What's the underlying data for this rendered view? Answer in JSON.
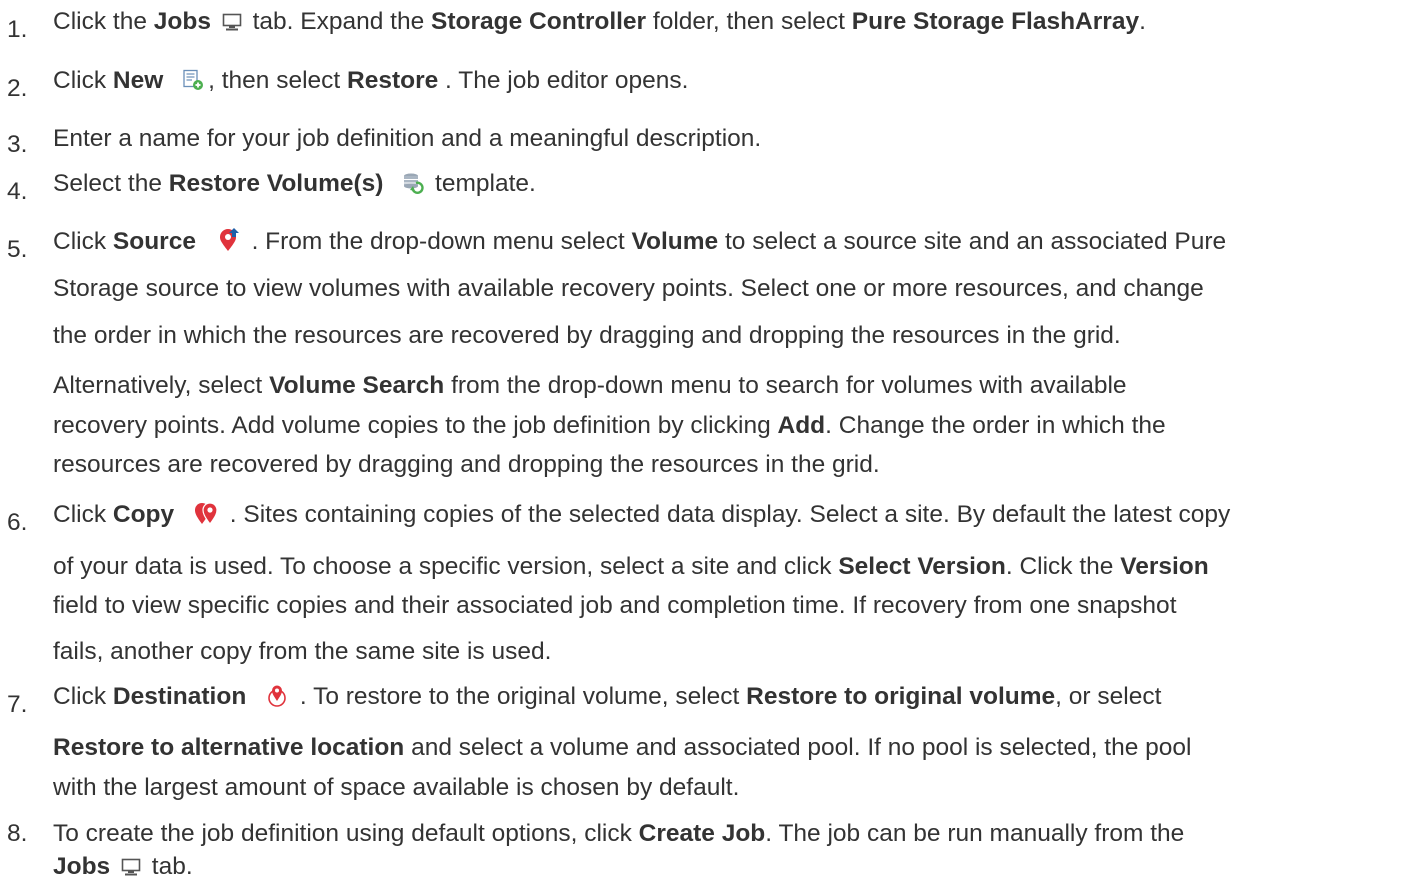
{
  "steps": [
    {
      "number": "1.",
      "t1": "Click the ",
      "b1": "Jobs",
      "t2": " tab. Expand the ",
      "b2": "Storage Controller",
      "t3": " folder, then select ",
      "b3": "Pure Storage FlashArray",
      "t4": ".",
      "icon": "monitor-icon"
    },
    {
      "number": "2.",
      "t1": "Click ",
      "b1": "New",
      "t2": ", then select ",
      "b2": "Restore",
      "t3": " . The job editor opens.",
      "icon": "new-job-icon"
    },
    {
      "number": "3.",
      "t1": "Enter a name for your job definition and a meaningful description."
    },
    {
      "number": "4.",
      "t1": "Select the ",
      "b1": "Restore Volume(s)",
      "t2": " template.",
      "icon": "restore-volumes-icon"
    },
    {
      "number": "5.",
      "l1a": "Click ",
      "l1b": "Source",
      "l1c": " . From the drop-down menu select ",
      "l1d": "Volume",
      "l1e": " to select a source site and an associated Pure",
      "l2": "Storage source to view volumes with available recovery points. Select one or more resources, and change",
      "l3": "the order in which the resources are recovered by dragging and dropping the resources in the grid.",
      "l4a": "Alternatively, select ",
      "l4b": "Volume Search",
      "l4c": " from the drop-down menu to search for volumes with available",
      "l5a": "recovery points. Add volume copies to the job definition by clicking ",
      "l5b": "Add",
      "l5c": ". Change the order in which the",
      "l6": "resources are recovered by dragging and dropping the resources in the grid.",
      "icon": "source-pin-icon"
    },
    {
      "number": "6.",
      "l1a": "Click ",
      "l1b": "Copy",
      "l1c": " . Sites containing copies of the selected data display. Select a site. By default the latest copy",
      "l2a": "of your data is used. To choose a specific version, select a site and click ",
      "l2b": "Select Version",
      "l2c": ". Click the ",
      "l2d": "Version",
      "l3": "field to view specific copies and their associated job and completion time. If recovery from one snapshot",
      "l4": "fails, another copy from the same site is used.",
      "icon": "copy-pin-icon"
    },
    {
      "number": "7.",
      "l1a": "Click ",
      "l1b": "Destination",
      "l1c": " . To restore to the original volume, select ",
      "l1d": "Restore to original volume",
      "l1e": ", or select",
      "l2a": "Restore to alternative location",
      "l2b": " and select a volume and associated pool. If no pool is selected, the pool",
      "l3": "with the largest amount of space available is chosen by default.",
      "icon": "destination-pin-icon"
    },
    {
      "number": "8.",
      "l1a": "To create the job definition using default options, click ",
      "l1b": "Create Job",
      "l1c": ". The job can be run manually from the",
      "l2a": "Jobs",
      "l2b": " tab.",
      "icon": "monitor-icon"
    }
  ],
  "colors": {
    "text": "#333333",
    "icon_blue": "#1f5fa8",
    "icon_red": "#e0333c",
    "icon_green": "#4caf50"
  }
}
